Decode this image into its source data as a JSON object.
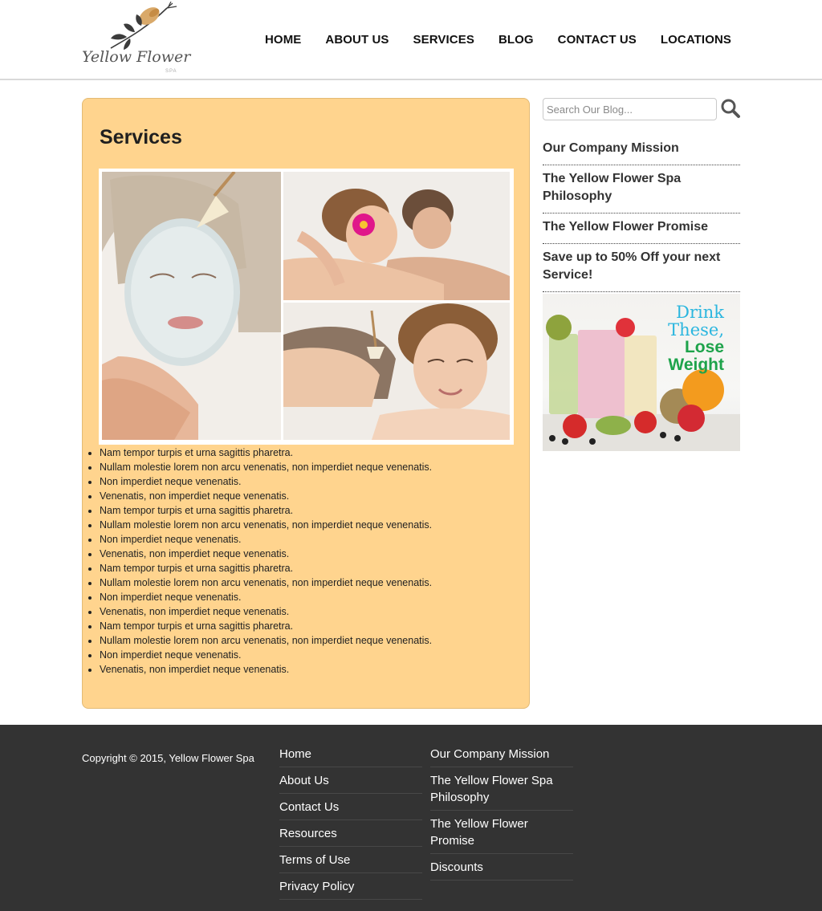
{
  "brand": {
    "name": "Yellow Flower",
    "sub": "SPA"
  },
  "nav": {
    "items": [
      {
        "label": "HOME"
      },
      {
        "label": "ABOUT US"
      },
      {
        "label": "SERVICES"
      },
      {
        "label": "BLOG"
      },
      {
        "label": "CONTACT US"
      },
      {
        "label": "LOCATIONS"
      }
    ]
  },
  "main": {
    "title": "Services",
    "bullets": [
      "Nam tempor turpis et urna sagittis pharetra.",
      "Nullam molestie lorem non arcu venenatis, non imperdiet neque venenatis.",
      "Non imperdiet neque venenatis.",
      "Venenatis, non imperdiet neque venenatis.",
      "Nam tempor turpis et urna sagittis pharetra.",
      "Nullam molestie lorem non arcu venenatis, non imperdiet neque venenatis.",
      "Non imperdiet neque venenatis.",
      "Venenatis, non imperdiet neque venenatis.",
      "Nam tempor turpis et urna sagittis pharetra.",
      "Nullam molestie lorem non arcu venenatis, non imperdiet neque venenatis.",
      "Non imperdiet neque venenatis.",
      "Venenatis, non imperdiet neque venenatis.",
      "Nam tempor turpis et urna sagittis pharetra.",
      "Nullam molestie lorem non arcu venenatis, non imperdiet neque venenatis.",
      "Non imperdiet neque venenatis.",
      "Venenatis, non imperdiet neque venenatis."
    ]
  },
  "sidebar": {
    "search_placeholder": "Search Our Blog...",
    "links": [
      {
        "label": "Our Company Mission"
      },
      {
        "label": "The Yellow Flower Spa Philosophy"
      },
      {
        "label": "The Yellow Flower Promise"
      },
      {
        "label": "Save up to 50% Off your next Service!"
      }
    ],
    "ad": {
      "line1": "Drink",
      "line2": "These,",
      "line3": "Lose",
      "line4": "Weight"
    }
  },
  "footer": {
    "copyright": "Copyright © 2015, Yellow Flower Spa",
    "col1": [
      {
        "label": "Home"
      },
      {
        "label": "About Us"
      },
      {
        "label": "Contact Us"
      },
      {
        "label": "Resources"
      },
      {
        "label": "Terms of Use"
      },
      {
        "label": "Privacy Policy"
      }
    ],
    "col2": [
      {
        "label": "Our Company Mission"
      },
      {
        "label": "The Yellow Flower Spa Philosophy"
      },
      {
        "label": "The Yellow Flower Promise"
      },
      {
        "label": "Discounts"
      }
    ]
  },
  "colors": {
    "content_bg": "#ffd48e",
    "footer_bg": "#333333",
    "ad_blue": "#2bb6df",
    "ad_green": "#1ea34b"
  }
}
